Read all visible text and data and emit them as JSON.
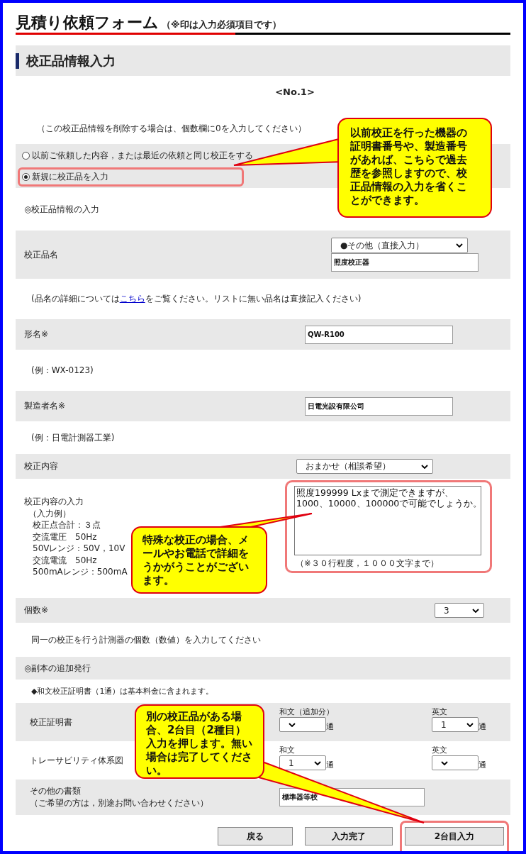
{
  "title": "見積り依頼フォーム",
  "title_note": "（※印は入力必須項目です）",
  "section": "校正品情報入力",
  "number": "<No.1>",
  "delete_note": "（この校正品情報を削除する場合は、個数欄に0を入力してください）",
  "radios": [
    {
      "label": "以前ご依頼した内容，または最近の依頼と同じ校正をする",
      "selected": false,
      "highlighted": false
    },
    {
      "label": "新規に校正品を入力",
      "selected": true,
      "highlighted": true
    }
  ],
  "subheading": "◎校正品情報の入力",
  "product": {
    "label": "校正品名",
    "select": "●その他（直接入力）",
    "value": "照度校正器",
    "note_before": "(品名の詳細については",
    "link": "こちら",
    "note_after": "をご覧ください。リストに無い品名は直接記入ください)"
  },
  "model": {
    "label": "形名※",
    "value": "QW-R100",
    "example": "(例：WX-0123)"
  },
  "maker": {
    "label": "製造者名※",
    "value": "日電光設有限公司",
    "example": "(例：日電計測器工業)"
  },
  "content": {
    "label": "校正内容",
    "select": "おまかせ（相談希望）",
    "input_label": "校正内容の入力",
    "example_lines": [
      "（入力例）",
      "校正点合計：３点",
      "交流電圧　50Hz",
      "50Vレンジ：50V，10V",
      "交流電流　50Hz",
      "500mAレンジ：500mA"
    ],
    "text": "照度199999 Lxまで測定できますが、\n1000、10000、100000で可能でしょうか。",
    "limit": "（※３０行程度，１０００文字まで）",
    "highlighted": true
  },
  "quantity": {
    "label": "個数※",
    "value": "3",
    "note": "同一の校正を行う計測器の個数（数値）を入力してください"
  },
  "copies": {
    "heading": "◎副本の追加発行",
    "note": "◆和文校正証明書（1通）は基本料金に含まれます。",
    "rows": [
      {
        "label": "校正証明書",
        "cols": [
          {
            "header": "和文（追加分）",
            "unit": "通"
          },
          {
            "header": "英文",
            "value": "1",
            "unit": "通"
          }
        ]
      },
      {
        "label": "トレーサビリティ体系図",
        "cols": [
          {
            "header": "和文",
            "value": "1",
            "unit": "通"
          },
          {
            "header": "英文",
            "unit": "通"
          }
        ]
      }
    ]
  },
  "other": {
    "label": "その他の書類",
    "sublabel": "（ご希望の方は，別途お問い合わせください）",
    "value": "標準器等校"
  },
  "buttons": [
    {
      "label": "戻る",
      "highlighted": false
    },
    {
      "label": "入力完了",
      "highlighted": false
    },
    {
      "label": "2台目入力",
      "highlighted": true
    }
  ],
  "callouts": [
    {
      "text": "以前校正を行った機器の証明書番号や、製造番号があれば、こちらで過去歴を参照しますので、校正品情報の入力を省くことができます。"
    },
    {
      "text": "特殊な校正の場合、メールやお電話で詳細をうかがうことがございます。"
    },
    {
      "text": "別の校正品がある場合、2台目（2種目）入力を押します。無い場合は完了してください。"
    }
  ]
}
